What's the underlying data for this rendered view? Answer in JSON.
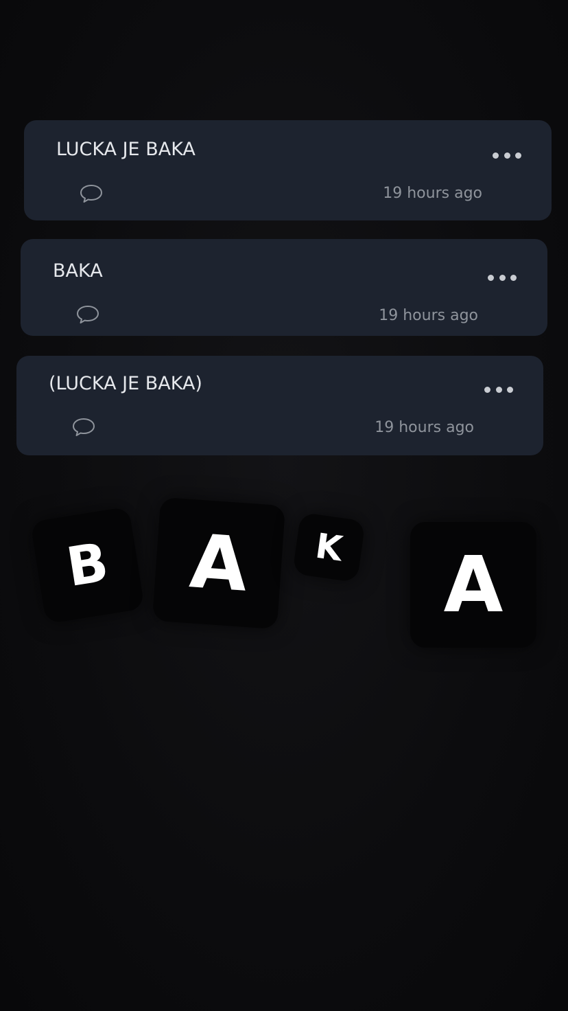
{
  "posts": [
    {
      "title": "LUCKA JE BAKA",
      "timestamp": "19 hours ago",
      "more_icon": "more-horizontal-icon",
      "comment_icon": "comment-bubble-icon"
    },
    {
      "title": "BAKA",
      "timestamp": "19 hours ago",
      "more_icon": "more-horizontal-icon",
      "comment_icon": "comment-bubble-icon"
    },
    {
      "title": "(LUCKA JE BAKA)",
      "timestamp": "19 hours ago",
      "more_icon": "more-horizontal-icon",
      "comment_icon": "comment-bubble-icon"
    }
  ],
  "stickers": [
    "B",
    "A",
    "K",
    "A"
  ],
  "colors": {
    "background": "#0d0d0f",
    "card": "#1d232f",
    "title_text": "#e6e8ec",
    "muted_text": "#8f949c",
    "sticker_bg": "#050506",
    "sticker_text": "#ffffff"
  }
}
